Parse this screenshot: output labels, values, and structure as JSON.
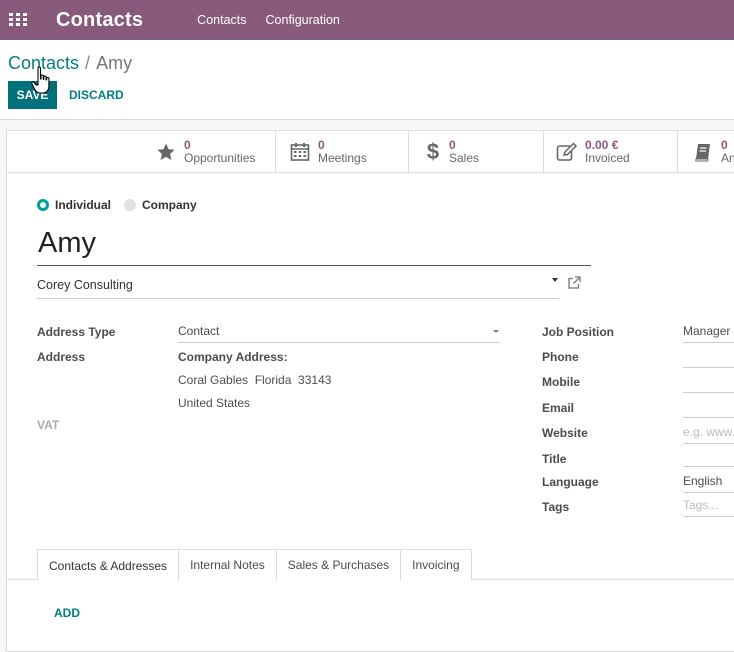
{
  "topbar": {
    "app_title": "Contacts",
    "menu": [
      "Contacts",
      "Configuration"
    ]
  },
  "breadcrumb": {
    "parent": "Contacts",
    "separator": "/",
    "current": "Amy"
  },
  "buttons": {
    "save": "SAVE",
    "discard": "DISCARD"
  },
  "stat_buttons": [
    {
      "value": "0",
      "label": "Opportunities",
      "icon": "star-icon"
    },
    {
      "value": "0",
      "label": "Meetings",
      "icon": "calendar-icon"
    },
    {
      "value": "0",
      "label": "Sales",
      "icon": "dollar-icon"
    },
    {
      "value": "0.00 €",
      "label": "Invoiced",
      "icon": "edit-icon"
    },
    {
      "value": "0",
      "label": "An",
      "icon": "book-icon"
    }
  ],
  "company_type": {
    "individual": "Individual",
    "company": "Company",
    "selected": "Individual"
  },
  "contact": {
    "name": "Amy",
    "company": "Corey Consulting"
  },
  "left_fields": {
    "address_type_label": "Address Type",
    "address_type_value": "Contact",
    "address_label": "Address",
    "company_address_heading": "Company Address:",
    "address_line1": "Coral Gables  Florida  33143",
    "address_line2": "United States",
    "vat_label": "VAT"
  },
  "right_fields": {
    "job_position_label": "Job Position",
    "job_position_value": "Manager",
    "phone_label": "Phone",
    "mobile_label": "Mobile",
    "email_label": "Email",
    "website_label": "Website",
    "website_placeholder": "e.g. www.",
    "title_label": "Title",
    "language_label": "Language",
    "language_value": "English",
    "tags_label": "Tags",
    "tags_placeholder": "Tags..."
  },
  "tabs": [
    "Contacts & Addresses",
    "Internal Notes",
    "Sales & Purchases",
    "Invoicing"
  ],
  "active_tab": "Contacts & Addresses",
  "tab_content": {
    "add": "ADD"
  },
  "colors": {
    "topbar": "#875a7b",
    "primary": "#00717a",
    "link": "#017e84",
    "radio_active": "#00a09d"
  }
}
